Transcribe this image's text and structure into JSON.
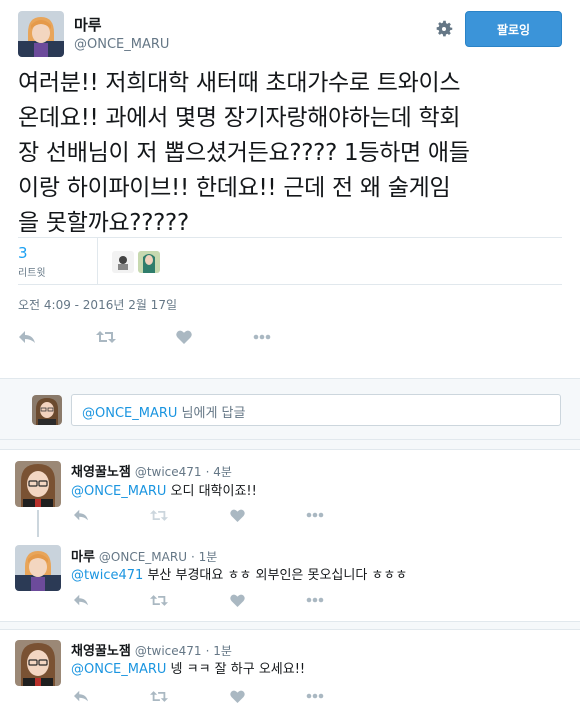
{
  "main_tweet": {
    "author_name": "마루",
    "author_handle": "@ONCE_MARU",
    "follow_label": "팔로잉",
    "text_lines": [
      "여러분!!  저희대학 새터때 초대가수로 트와이스",
      "온데요!!  과에서 몇명 장기자랑해야하는데 학회",
      "장 선배님이 저 뽑으셨거든요???? 1등하면 애들",
      "이랑 하이파이브!!  한데요!!  근데 전 왜 술게임",
      "을 못할까요?????"
    ],
    "retweet_count": "3",
    "retweet_label": "리트윗",
    "timestamp": "오전 4:09 - 2016년 2월 17일"
  },
  "reply_box": {
    "mention": "@ONCE_MARU",
    "suffix": " 님에게 답글"
  },
  "replies": [
    {
      "name": "채영꿀노잼",
      "handle": "@twice471",
      "time": "· 4분",
      "mention": "@ONCE_MARU",
      "text": " 오디 대학이죠!!"
    },
    {
      "name": "마루",
      "handle": "@ONCE_MARU",
      "time": "· 1분",
      "mention": "@twice471",
      "text": " 부산 부경대요 ㅎㅎ 외부인은 못오십니다 ㅎㅎㅎ"
    },
    {
      "name": "채영꿀노잼",
      "handle": "@twice471",
      "time": "· 1분",
      "mention": "@ONCE_MARU",
      "text": " 넹 ㅋㅋ 잘 하구 오세요!!"
    }
  ],
  "icons": [
    "gear-icon",
    "reply-icon",
    "retweet-icon",
    "like-icon",
    "more-icon"
  ],
  "colors": {
    "accent": "#1da1f2",
    "follow_button": "#3b94d9",
    "muted": "#657786",
    "icon": "#aab8c2"
  }
}
